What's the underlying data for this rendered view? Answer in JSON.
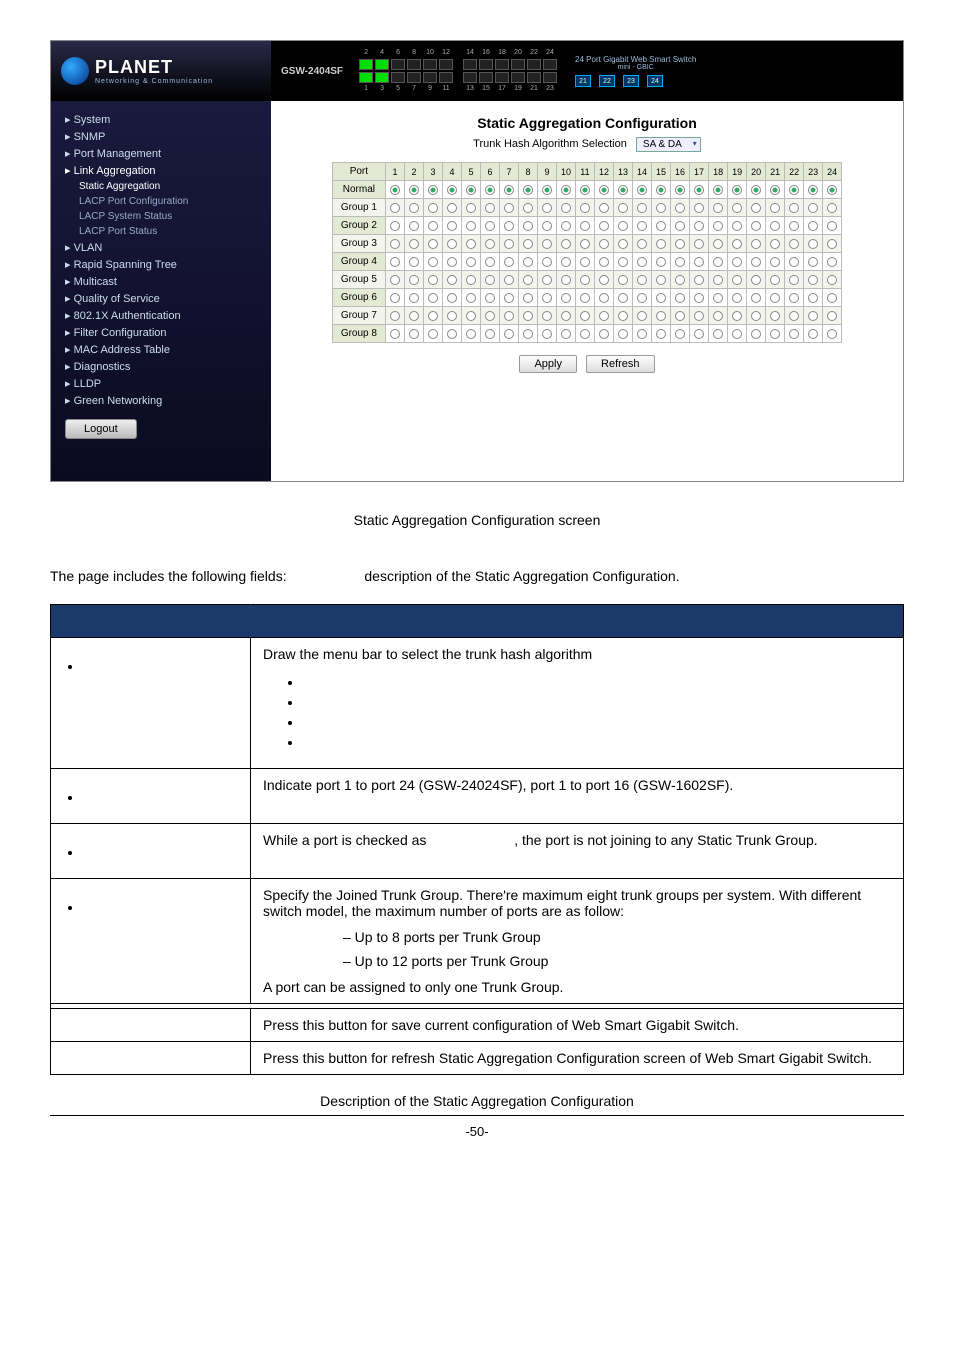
{
  "header": {
    "model": "GSW-2404SF",
    "brand_name": "PLANET",
    "brand_sub": "Networking & Communication",
    "gbic_title": "24 Port Gigabit Web Smart Switch",
    "gbic_sub": "mini - GBIC",
    "gbic_ports": [
      "21",
      "22",
      "23",
      "24"
    ],
    "top_nums": [
      "2",
      "4",
      "6",
      "8",
      "10",
      "12",
      "14",
      "16",
      "18",
      "20",
      "22",
      "24"
    ],
    "bot_nums": [
      "1",
      "3",
      "5",
      "7",
      "9",
      "11",
      "13",
      "15",
      "17",
      "19",
      "21",
      "23"
    ]
  },
  "sidebar": {
    "items": [
      {
        "label": "System",
        "sub": false
      },
      {
        "label": "SNMP",
        "sub": false
      },
      {
        "label": "Port Management",
        "sub": false
      },
      {
        "label": "Link Aggregation",
        "sub": false,
        "sel": true
      },
      {
        "label": "Static Aggregation",
        "sub": true,
        "sel": true
      },
      {
        "label": "LACP Port Configuration",
        "sub": true
      },
      {
        "label": "LACP System Status",
        "sub": true
      },
      {
        "label": "LACP Port Status",
        "sub": true
      },
      {
        "label": "VLAN",
        "sub": false
      },
      {
        "label": "Rapid Spanning Tree",
        "sub": false
      },
      {
        "label": "Multicast",
        "sub": false
      },
      {
        "label": "Quality of Service",
        "sub": false
      },
      {
        "label": "802.1X Authentication",
        "sub": false
      },
      {
        "label": "Filter Configuration",
        "sub": false
      },
      {
        "label": "MAC Address Table",
        "sub": false
      },
      {
        "label": "Diagnostics",
        "sub": false
      },
      {
        "label": "LLDP",
        "sub": false
      },
      {
        "label": "Green Networking",
        "sub": false
      }
    ],
    "logout": "Logout"
  },
  "main": {
    "title": "Static Aggregation Configuration",
    "hash_label": "Trunk Hash Algorithm Selection",
    "hash_value": "SA & DA",
    "port_label": "Port",
    "ports": [
      "1",
      "2",
      "3",
      "4",
      "5",
      "6",
      "7",
      "8",
      "9",
      "10",
      "11",
      "12",
      "13",
      "14",
      "15",
      "16",
      "17",
      "18",
      "19",
      "20",
      "21",
      "22",
      "23",
      "24"
    ],
    "rows": [
      "Normal",
      "Group 1",
      "Group 2",
      "Group 3",
      "Group 4",
      "Group 5",
      "Group 6",
      "Group 7",
      "Group 8"
    ],
    "apply": "Apply",
    "refresh": "Refresh"
  },
  "doc": {
    "figcap": "Static Aggregation Configuration screen",
    "lead_a": "The page includes the following fields:",
    "lead_b": "description of the Static Aggregation Configuration.",
    "rows": {
      "hash": "Draw the menu bar to select the trunk hash algorithm",
      "port": "Indicate port 1 to port 24 (GSW-24024SF), port 1 to port 16 (GSW-1602SF).",
      "normal_a": "While a port is checked as",
      "normal_b": ", the port is not joining to any Static Trunk Group.",
      "group_a": "Specify the Joined Trunk Group. There're maximum eight trunk groups per system. With different switch model, the maximum number of ports are as follow:",
      "group_b": "– Up to 8 ports per Trunk Group",
      "group_c": "– Up to 12 ports per Trunk Group",
      "group_d": "A port can be assigned to only one Trunk Group.",
      "apply": "Press this button for save current configuration of Web Smart Gigabit Switch.",
      "refresh": "Press this button for refresh Static Aggregation Configuration screen of Web Smart Gigabit Switch."
    },
    "tabcap": "Description of the Static Aggregation Configuration",
    "pageno": "-50-"
  }
}
